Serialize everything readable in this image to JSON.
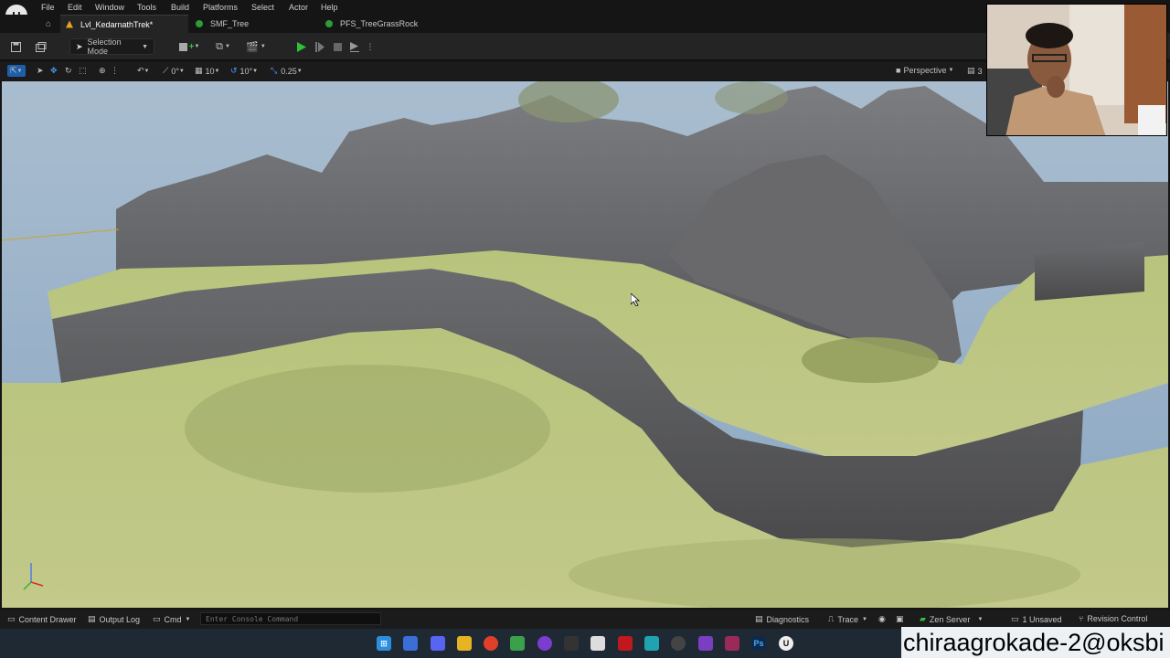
{
  "app": {
    "logo_glyph": "U"
  },
  "menu": [
    "File",
    "Edit",
    "Window",
    "Tools",
    "Build",
    "Platforms",
    "Select",
    "Actor",
    "Help"
  ],
  "tabs": [
    {
      "label": "Lvl_KedarnathTrek*",
      "active": true,
      "color": "#e8a020"
    },
    {
      "label": "SMF_Tree",
      "active": false,
      "color": "#2e9a3a"
    },
    {
      "label": "PFS_TreeGrassRock",
      "active": false,
      "color": "#2e9a3a"
    }
  ],
  "toolbar": {
    "selection_mode": "Selection Mode",
    "play_icon": "play-icon"
  },
  "viewport_toolbar": {
    "rotation_snap": "0°",
    "grid_snap": "10",
    "angle_snap": "10°",
    "scale_snap": "0.25",
    "view_mode": "Perspective",
    "right_number": "3"
  },
  "statusbar": {
    "content_drawer": "Content Drawer",
    "output_log": "Output Log",
    "cmd": "Cmd",
    "console_placeholder": "Enter Console Command",
    "diagnostics": "Diagnostics",
    "trace": "Trace",
    "zen_server": "Zen Server",
    "unsaved": "1 Unsaved",
    "revision_control": "Revision Control"
  },
  "watermark": "chiraagrokade-2@oksbi",
  "colors": {
    "sky": "#9fb6cc",
    "grass": "#b6bf7c",
    "rock": "#5a5a5c",
    "accent_green": "#2fbf3a"
  }
}
